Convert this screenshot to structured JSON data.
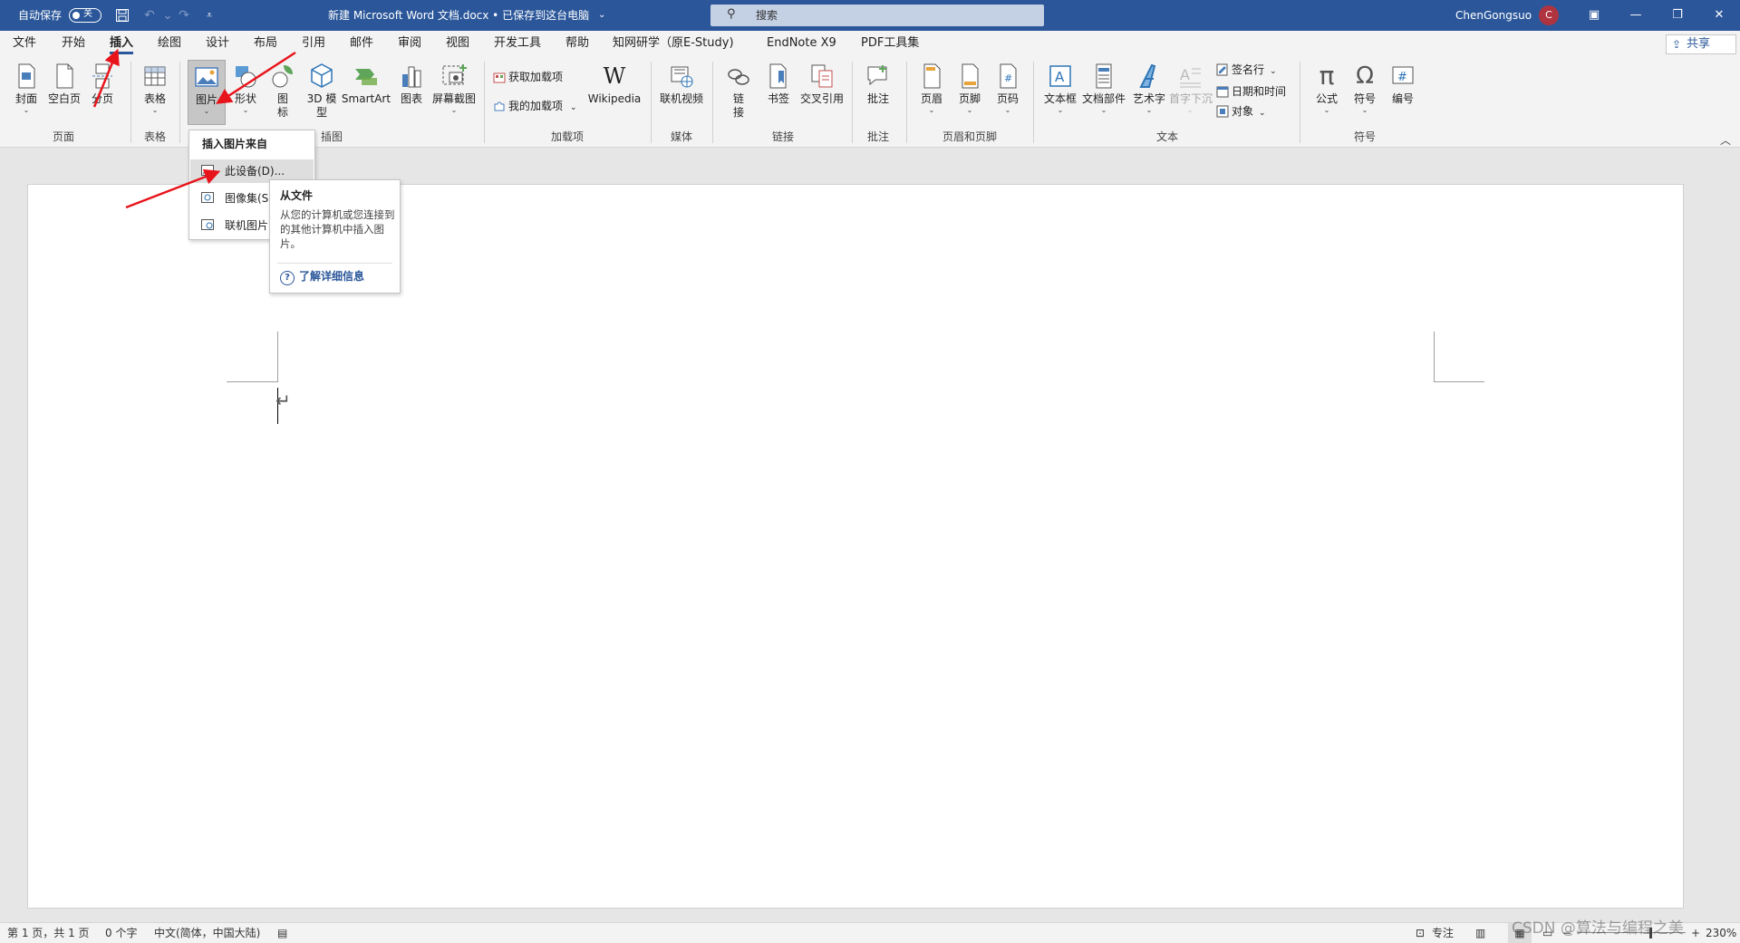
{
  "titlebar": {
    "autosave_label": "自动保存",
    "autosave_state": "关",
    "document_title": "新建 Microsoft Word 文档.docx • 已保存到这台电脑",
    "search_placeholder": "搜索",
    "user_name": "ChenGongsuo",
    "avatar_initial": "C"
  },
  "tabs": [
    "文件",
    "开始",
    "插入",
    "绘图",
    "设计",
    "布局",
    "引用",
    "邮件",
    "审阅",
    "视图",
    "开发工具",
    "帮助",
    "知网研学（原E-Study)",
    "EndNote X9",
    "PDF工具集"
  ],
  "active_tab": "插入",
  "share_label": "共享",
  "ribbon": {
    "pages": {
      "cover": "封面",
      "blank": "空白页",
      "break": "分页",
      "group": "页面"
    },
    "tables": {
      "table": "表格",
      "group": "表格"
    },
    "illustrations": {
      "picture": "图片",
      "shapes": "形状",
      "icons_1": "图",
      "icons_2": "标",
      "model3d_1": "3D 模",
      "model3d_2": "型",
      "smartart": "SmartArt",
      "chart": "图表",
      "screenshot": "屏幕截图",
      "group": "插图"
    },
    "addins": {
      "get": "获取加载项",
      "mine": "我的加载项",
      "wikipedia": "Wikipedia",
      "group": "加载项"
    },
    "media": {
      "online_video": "联机视频",
      "group": "媒体"
    },
    "links": {
      "link_1": "链",
      "link_2": "接",
      "bookmark": "书签",
      "crossref": "交叉引用",
      "group": "链接"
    },
    "comments": {
      "comment": "批注",
      "group": "批注"
    },
    "headerfooter": {
      "header": "页眉",
      "footer": "页脚",
      "pagenum": "页码",
      "group": "页眉和页脚"
    },
    "text": {
      "textbox": "文本框",
      "quickparts": "文档部件",
      "wordart": "艺术字",
      "dropcap": "首字下沉",
      "signature": "签名行",
      "datetime": "日期和时间",
      "object": "对象",
      "group": "文本"
    },
    "symbols": {
      "equation": "公式",
      "symbol": "符号",
      "number": "编号",
      "group": "符号"
    }
  },
  "dropdown": {
    "header": "插入图片来自",
    "items": [
      "此设备(D)...",
      "图像集(S)",
      "联机图片(O)"
    ]
  },
  "tooltip": {
    "title": "从文件",
    "description": "从您的计算机或您连接到的其他计算机中插入图片。",
    "learn_more": "了解详细信息"
  },
  "status": {
    "page": "第 1 页，共 1 页",
    "words": "0 个字",
    "language": "中文(简体，中国大陆)",
    "focus": "专注",
    "zoom": "230%"
  },
  "watermark": "CSDN @算法与编程之美",
  "colors": {
    "title_bar": "#2b579a",
    "annotation_arrow": "#e8141c",
    "avatar": "#b03340"
  }
}
